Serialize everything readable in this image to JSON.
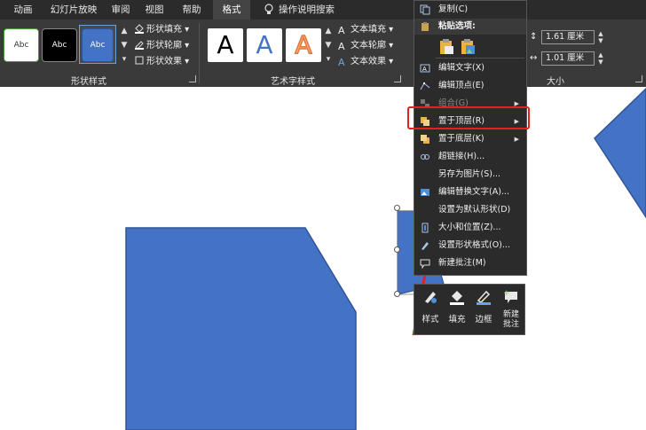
{
  "tabs": [
    "动画",
    "幻灯片放映",
    "审阅",
    "视图",
    "帮助",
    "格式",
    "操作说明搜索"
  ],
  "active_tab": "格式",
  "shape_styles": {
    "thumbs": [
      "Abc",
      "Abc",
      "Abc"
    ],
    "fill_label": "形状填充",
    "outline_label": "形状轮廓",
    "effects_label": "形状效果",
    "group_label": "形状样式"
  },
  "wordart": {
    "thumbs": [
      "A",
      "A",
      "A"
    ],
    "fill_label": "文本填充",
    "outline_label": "文本轮廓",
    "effects_label": "文本效果",
    "group_label": "艺术字样式"
  },
  "size": {
    "height_value": "1.61 厘米",
    "width_value": "1.01 厘米",
    "group_label": "大小"
  },
  "context_menu": {
    "copy": "复制(C)",
    "paste_options": "粘贴选项:",
    "edit_text": "编辑文字(X)",
    "edit_points": "编辑顶点(E)",
    "group": "组合(G)",
    "bring_to_front": "置于顶层(R)",
    "send_to_back": "置于底层(K)",
    "hyperlink": "超链接(H)...",
    "save_as_picture": "另存为图片(S)...",
    "edit_alt_text": "编辑替换文字(A)...",
    "set_default_shape": "设置为默认形状(D)",
    "size_position": "大小和位置(Z)...",
    "format_shape": "设置形状格式(O)...",
    "new_comment": "新建批注(M)"
  },
  "mini_toolbar": {
    "style": "样式",
    "fill": "填充",
    "outline": "边框",
    "new_comment": "新建批注"
  },
  "colors": {
    "shape_fill": "#4472c4",
    "shape_stroke": "#2f5597",
    "highlight": "#e0231d",
    "ribbon_bg": "#3a3a3a"
  }
}
